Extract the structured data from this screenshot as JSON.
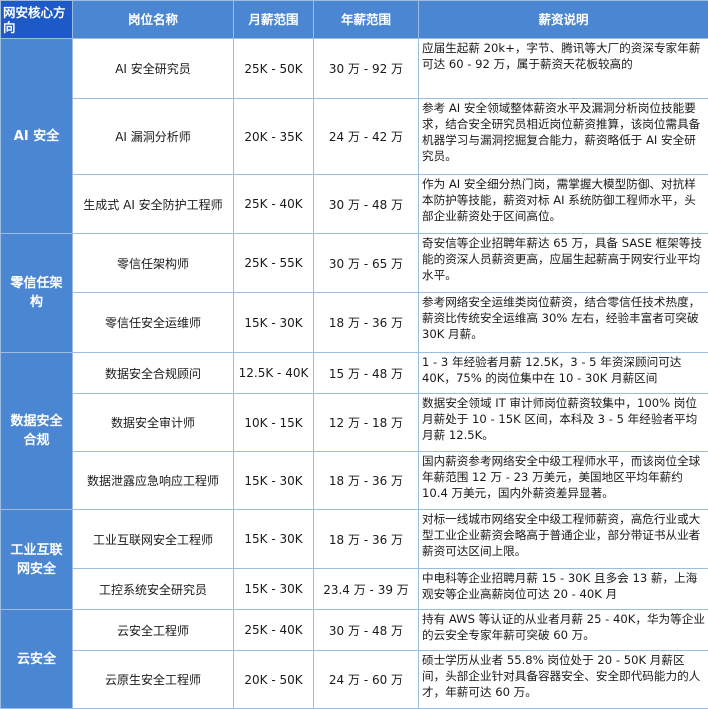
{
  "headers": [
    "网安核心方向",
    "岗位名称",
    "月薪范围",
    "年薪范围",
    "薪资说明"
  ],
  "categories": [
    {
      "name": "AI 安全",
      "rows": [
        {
          "title": "AI 安全研究员",
          "monthly": "25K - 50K",
          "annual": "30 万 - 92 万",
          "desc": "应届生起薪 20k+，字节、腾讯等大厂的资深专家年薪可达 60 - 92 万，属于薪资天花板较高的"
        },
        {
          "title": "AI 漏洞分析师",
          "monthly": "20K - 35K",
          "annual": "24 万 - 42 万",
          "desc": "参考 AI 安全领域整体薪资水平及漏洞分析岗位技能要求，结合安全研究员相近岗位薪资推算，该岗位需具备机器学习与漏洞挖掘复合能力，薪资略低于 AI 安全研究员。"
        },
        {
          "title": "生成式 AI 安全防护工程师",
          "monthly": "25K - 40K",
          "annual": "30 万 - 48 万",
          "desc": "作为 AI 安全细分热门岗，需掌握大模型防御、对抗样本防护等技能，薪资对标 AI 系统防御工程师水平，头部企业薪资处于区间高位。"
        }
      ]
    },
    {
      "name": "零信任架构",
      "rows": [
        {
          "title": "零信任架构师",
          "monthly": "25K - 55K",
          "annual": "30 万 - 65 万",
          "desc": "奇安信等企业招聘年薪达 65 万，具备 SASE 框架等技能的资深人员薪资更高，应届生起薪高于网安行业平均水平。"
        },
        {
          "title": "零信任安全运维师",
          "monthly": "15K - 30K",
          "annual": "18 万 - 36 万",
          "desc": "参考网络安全运维类岗位薪资，结合零信任技术热度，薪资比传统安全运维高 30% 左右，经验丰富者可突破 30K 月薪。"
        }
      ]
    },
    {
      "name": "数据安全合规",
      "rows": [
        {
          "title": "数据安全合规顾问",
          "monthly": "12.5K - 40K",
          "annual": "15 万 - 48 万",
          "desc": "1 - 3 年经验者月薪 12.5K，3 - 5 年资深顾问可达 40K，75% 的岗位集中在 10 - 30K 月薪区间"
        },
        {
          "title": "数据安全审计师",
          "monthly": "10K - 15K",
          "annual": "12 万 - 18 万",
          "desc": "数据安全领域 IT 审计师岗位薪资较集中，100% 岗位月薪处于 10 - 15K 区间，本科及 3 - 5 年经验者平均月薪 12.5K。"
        },
        {
          "title": "数据泄露应急响应工程师",
          "monthly": "15K - 30K",
          "annual": "18 万 - 36 万",
          "desc": "国内薪资参考网络安全中级工程师水平，而该岗位全球年薪范围 12 万 - 23 万美元，美国地区平均年薪约 10.4 万美元，国内外薪资差异显著。"
        }
      ]
    },
    {
      "name": "工业互联网安全",
      "rows": [
        {
          "title": "工业互联网安全工程师",
          "monthly": "15K - 30K",
          "annual": "18 万 - 36 万",
          "desc": "对标一线城市网络安全中级工程师薪资，高危行业或大型工业企业薪资会略高于普通企业，部分带证书从业者薪资可达区间上限。"
        },
        {
          "title": "工控系统安全研究员",
          "monthly": "15K - 30K",
          "annual": "23.4 万 - 39 万",
          "desc": "中电科等企业招聘月薪 15 - 30K 且多会 13 薪，上海观安等企业高薪岗位可达 20 - 40K 月"
        }
      ]
    },
    {
      "name": "云安全",
      "rows": [
        {
          "title": "云安全工程师",
          "monthly": "25K - 40K",
          "annual": "30 万 - 48 万",
          "desc": "持有 AWS 等认证的从业者月薪 25 - 40K，华为等企业的云安全专家年薪可突破 60 万。"
        },
        {
          "title": "云原生安全工程师",
          "monthly": "20K - 50K",
          "annual": "24 万 - 60 万",
          "desc": "硕士学历从业者 55.8% 岗位处于 20 - 50K 月薪区间，头部企业针对具备容器安全、安全即代码能力的人才，年薪可达 60 万。"
        }
      ]
    }
  ]
}
